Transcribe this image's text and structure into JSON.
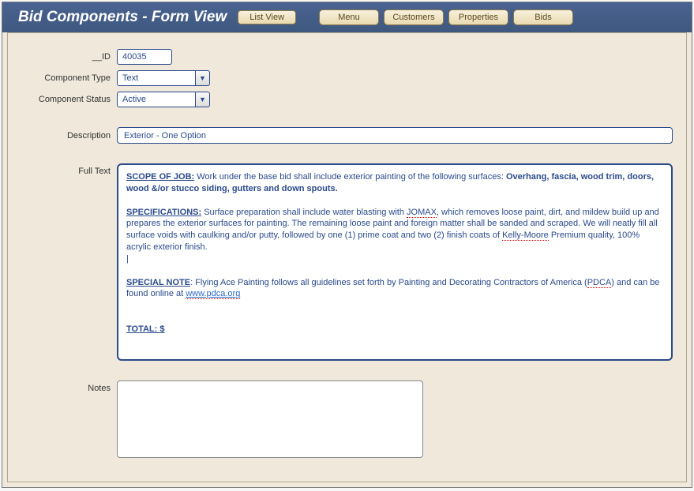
{
  "header": {
    "title": "Bid Components - Form View",
    "list_view_btn": "List View",
    "nav": {
      "menu": "Menu",
      "customers": "Customers",
      "properties": "Properties",
      "bids": "Bids"
    }
  },
  "form": {
    "id_label": "__ID",
    "id_value": "40035",
    "component_type_label": "Component Type",
    "component_type_value": "Text",
    "component_status_label": "Component Status",
    "component_status_value": "Active",
    "description_label": "Description",
    "description_value": "Exterior - One Option",
    "fulltext_label": "Full Text",
    "fulltext": {
      "scope_label": "SCOPE OF JOB:",
      "scope_text1": " Work under the base bid shall include exterior painting of the following surfaces: ",
      "scope_bold": "Overhang, fascia, wood trim, doors, wood &/or stucco siding, gutters and down spouts.",
      "spec_label": "SPECIFICATIONS:",
      "spec_text1": " Surface preparation shall include water blasting with ",
      "spec_jomax": "JOMAX",
      "spec_text2": ", which removes loose paint, dirt, and mildew build up and prepares the exterior surfaces for painting.  The remaining loose paint and foreign matter shall be sanded and scraped. We will neatly fill all surface voids with caulking and/or putty, followed by one (1) prime coat and two (2) finish coats of ",
      "spec_kelly": "Kelly-Moore",
      "spec_text3": " Premium quality, 100% acrylic exterior finish.",
      "note_label": "SPECIAL NOTE",
      "note_text1": ":  Flying Ace Painting follows all guidelines set forth by Painting and Decorating Contractors of America (",
      "note_pdca": "PDCA",
      "note_text2": ") and can be found online at ",
      "note_link": "www.pdca.org",
      "total_label": "TOTAL:  $"
    },
    "notes_label": "Notes",
    "notes_value": ""
  }
}
